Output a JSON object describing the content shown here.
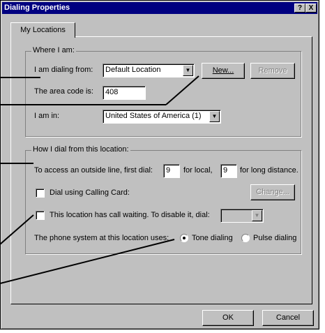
{
  "window": {
    "title": "Dialing Properties",
    "help_glyph": "?",
    "close_glyph": "X"
  },
  "tabs": [
    {
      "label": "My Locations"
    }
  ],
  "where": {
    "legend": "Where I am:",
    "dialing_from_label": "I am dialing from:",
    "dialing_from_value": "Default Location",
    "new_button": "New...",
    "remove_button": "Remove",
    "area_code_label": "The area code is:",
    "area_code_value": "408",
    "country_label": "I am in:",
    "country_value": "United States of America (1)"
  },
  "how": {
    "legend": "How I dial from this location:",
    "outside_line_label": "To access an outside line, first dial:",
    "local_value": "9",
    "for_local": "for local,",
    "long_distance_value": "9",
    "for_long_distance": "for long distance.",
    "calling_card_label": "Dial using Calling Card:",
    "calling_card_checked": false,
    "change_button": "Change...",
    "call_waiting_label": "This location has call waiting. To disable it, dial:",
    "call_waiting_checked": false,
    "call_waiting_value": "",
    "phone_system_label": "The phone system at this location uses:",
    "tone_label": "Tone dialing",
    "pulse_label": "Pulse dialing",
    "selected_dialing": "tone"
  },
  "footer": {
    "ok_button": "OK",
    "cancel_button": "Cancel"
  }
}
